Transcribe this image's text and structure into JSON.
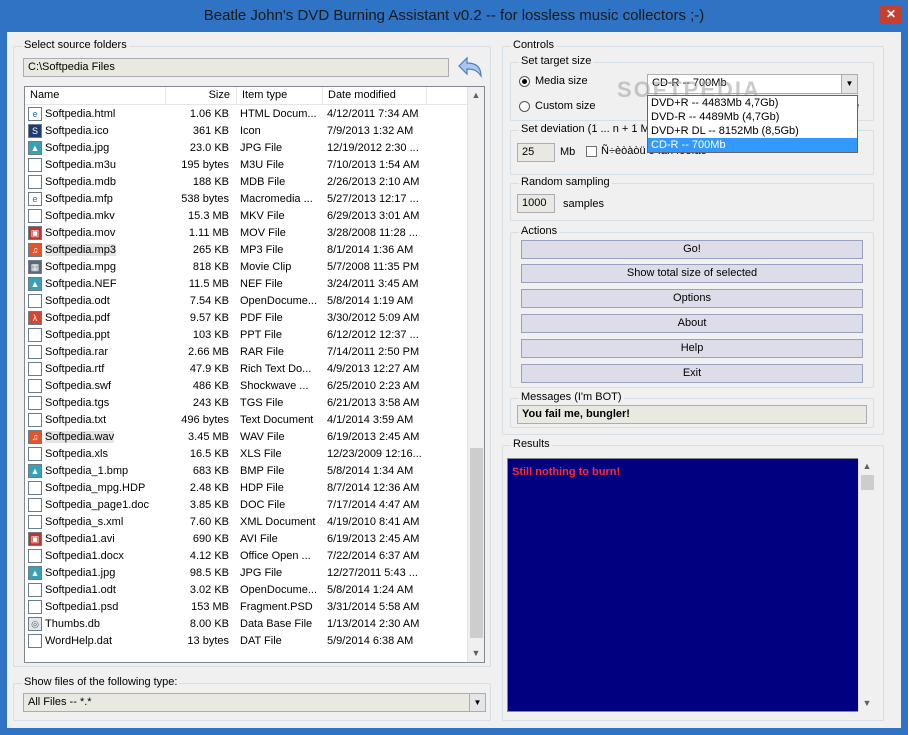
{
  "window": {
    "title": "Beatle John's DVD Burning Assistant v0.2 -- for lossless music collectors ;-)",
    "close": "✕"
  },
  "source": {
    "group_label": "Select source folders",
    "path": "C:\\Softpedia Files"
  },
  "filelist": {
    "columns": {
      "name": "Name",
      "size": "Size",
      "type": "Item type",
      "date": "Date modified"
    },
    "rows": [
      {
        "name": "Softpedia.html",
        "size": "1.06 KB",
        "type": "HTML Docum...",
        "date": "4/12/2011 7:34 AM",
        "icon": "html-icon"
      },
      {
        "name": "Softpedia.ico",
        "size": "361 KB",
        "type": "Icon",
        "date": "7/9/2013 1:32 AM",
        "icon": "ico-icon"
      },
      {
        "name": "Softpedia.jpg",
        "size": "23.0 KB",
        "type": "JPG File",
        "date": "12/19/2012 2:30 ...",
        "icon": "image-icon"
      },
      {
        "name": "Softpedia.m3u",
        "size": "195 bytes",
        "type": "M3U File",
        "date": "7/10/2013 1:54 AM",
        "icon": "file-icon"
      },
      {
        "name": "Softpedia.mdb",
        "size": "188 KB",
        "type": "MDB File",
        "date": "2/26/2013 2:10 AM",
        "icon": "file-icon"
      },
      {
        "name": "Softpedia.mfp",
        "size": "538 bytes",
        "type": "Macromedia ...",
        "date": "5/27/2013 12:17 ...",
        "icon": "html-icon"
      },
      {
        "name": "Softpedia.mkv",
        "size": "15.3 MB",
        "type": "MKV File",
        "date": "6/29/2013 3:01 AM",
        "icon": "file-icon"
      },
      {
        "name": "Softpedia.mov",
        "size": "1.11 MB",
        "type": "MOV File",
        "date": "3/28/2008 11:28 ...",
        "icon": "video-icon"
      },
      {
        "name": "Softpedia.mp3",
        "size": "265 KB",
        "type": "MP3 File",
        "date": "8/1/2014 1:36 AM",
        "icon": "audio-icon",
        "selected": true
      },
      {
        "name": "Softpedia.mpg",
        "size": "818 KB",
        "type": "Movie Clip",
        "date": "5/7/2008 11:35 PM",
        "icon": "movie-icon"
      },
      {
        "name": "Softpedia.NEF",
        "size": "11.5 MB",
        "type": "NEF File",
        "date": "3/24/2011 3:45 AM",
        "icon": "image-icon"
      },
      {
        "name": "Softpedia.odt",
        "size": "7.54 KB",
        "type": "OpenDocume...",
        "date": "5/8/2014 1:19 AM",
        "icon": "file-icon"
      },
      {
        "name": "Softpedia.pdf",
        "size": "9.57 KB",
        "type": "PDF File",
        "date": "3/30/2012 5:09 AM",
        "icon": "pdf-icon"
      },
      {
        "name": "Softpedia.ppt",
        "size": "103 KB",
        "type": "PPT File",
        "date": "6/12/2012 12:37 ...",
        "icon": "file-icon"
      },
      {
        "name": "Softpedia.rar",
        "size": "2.66 MB",
        "type": "RAR File",
        "date": "7/14/2011 2:50 PM",
        "icon": "file-icon"
      },
      {
        "name": "Softpedia.rtf",
        "size": "47.9 KB",
        "type": "Rich Text Do...",
        "date": "4/9/2013 12:27 AM",
        "icon": "file-icon"
      },
      {
        "name": "Softpedia.swf",
        "size": "486 KB",
        "type": "Shockwave ...",
        "date": "6/25/2010 2:23 AM",
        "icon": "file-icon"
      },
      {
        "name": "Softpedia.tgs",
        "size": "243 KB",
        "type": "TGS File",
        "date": "6/21/2013 3:58 AM",
        "icon": "file-icon"
      },
      {
        "name": "Softpedia.txt",
        "size": "496 bytes",
        "type": "Text Document",
        "date": "4/1/2014 3:59 AM",
        "icon": "file-icon"
      },
      {
        "name": "Softpedia.wav",
        "size": "3.45 MB",
        "type": "WAV File",
        "date": "6/19/2013 2:45 AM",
        "icon": "audio-icon",
        "selected": true
      },
      {
        "name": "Softpedia.xls",
        "size": "16.5 KB",
        "type": "XLS File",
        "date": "12/23/2009 12:16...",
        "icon": "file-icon"
      },
      {
        "name": "Softpedia_1.bmp",
        "size": "683 KB",
        "type": "BMP File",
        "date": "5/8/2014 1:34 AM",
        "icon": "image-icon"
      },
      {
        "name": "Softpedia_mpg.HDP",
        "size": "2.48 KB",
        "type": "HDP File",
        "date": "8/7/2014 12:36 AM",
        "icon": "file-icon"
      },
      {
        "name": "Softpedia_page1.doc",
        "size": "3.85 KB",
        "type": "DOC File",
        "date": "7/17/2014 4:47 AM",
        "icon": "file-icon"
      },
      {
        "name": "Softpedia_s.xml",
        "size": "7.60 KB",
        "type": "XML Document",
        "date": "4/19/2010 8:41 AM",
        "icon": "file-icon"
      },
      {
        "name": "Softpedia1.avi",
        "size": "690 KB",
        "type": "AVI File",
        "date": "6/19/2013 2:45 AM",
        "icon": "video-icon"
      },
      {
        "name": "Softpedia1.docx",
        "size": "4.12 KB",
        "type": "Office Open ...",
        "date": "7/22/2014 6:37 AM",
        "icon": "file-icon"
      },
      {
        "name": "Softpedia1.jpg",
        "size": "98.5 KB",
        "type": "JPG File",
        "date": "12/27/2011 5:43 ...",
        "icon": "image-icon"
      },
      {
        "name": "Softpedia1.odt",
        "size": "3.02 KB",
        "type": "OpenDocume...",
        "date": "5/8/2014 1:24 AM",
        "icon": "file-icon"
      },
      {
        "name": "Softpedia1.psd",
        "size": "153 MB",
        "type": "Fragment.PSD",
        "date": "3/31/2014 5:58 AM",
        "icon": "file-icon"
      },
      {
        "name": "Thumbs.db",
        "size": "8.00 KB",
        "type": "Data Base File",
        "date": "1/13/2014 2:30 AM",
        "icon": "db-icon"
      },
      {
        "name": "WordHelp.dat",
        "size": "13 bytes",
        "type": "DAT File",
        "date": "5/9/2014 6:38 AM",
        "icon": "file-icon"
      }
    ]
  },
  "filter": {
    "group_label": "Show files of the following type:",
    "value": "All Files -- *.*"
  },
  "controls": {
    "group_label": "Controls",
    "target": {
      "group_label": "Set target size",
      "media_label": "Media size",
      "custom_label": "Custom size",
      "selected_media": "CD-R -- 700Mb",
      "options": [
        "DVD+R -- 4483Mb 4,7Gb)",
        "DVD-R -- 4489Mb (4,7Gb)",
        "DVD+R DL -- 8152Mb (8,5Gb)",
        "CD-R -- 700Mb"
      ],
      "cut_suffix": "e"
    },
    "deviation": {
      "group_label": "Set deviation (1 ... n + 1 M",
      "value": "25",
      "unit": "Mb",
      "check_label": "Ñ÷èòàòü ó íàñ íóëîâó"
    },
    "sampling": {
      "group_label": "Random sampling",
      "value": "1000",
      "unit": "samples"
    },
    "actions": {
      "group_label": "Actions",
      "buttons": [
        "Go!",
        "Show total size of selected",
        "Options",
        "About",
        "Help",
        "Exit"
      ]
    },
    "messages": {
      "group_label": "Messages (I'm BOT)",
      "text": "You fail me, bungler!"
    }
  },
  "results": {
    "group_label": "Results",
    "text": "Still nothing to burn!"
  },
  "watermark": "SOFTPEDIA"
}
